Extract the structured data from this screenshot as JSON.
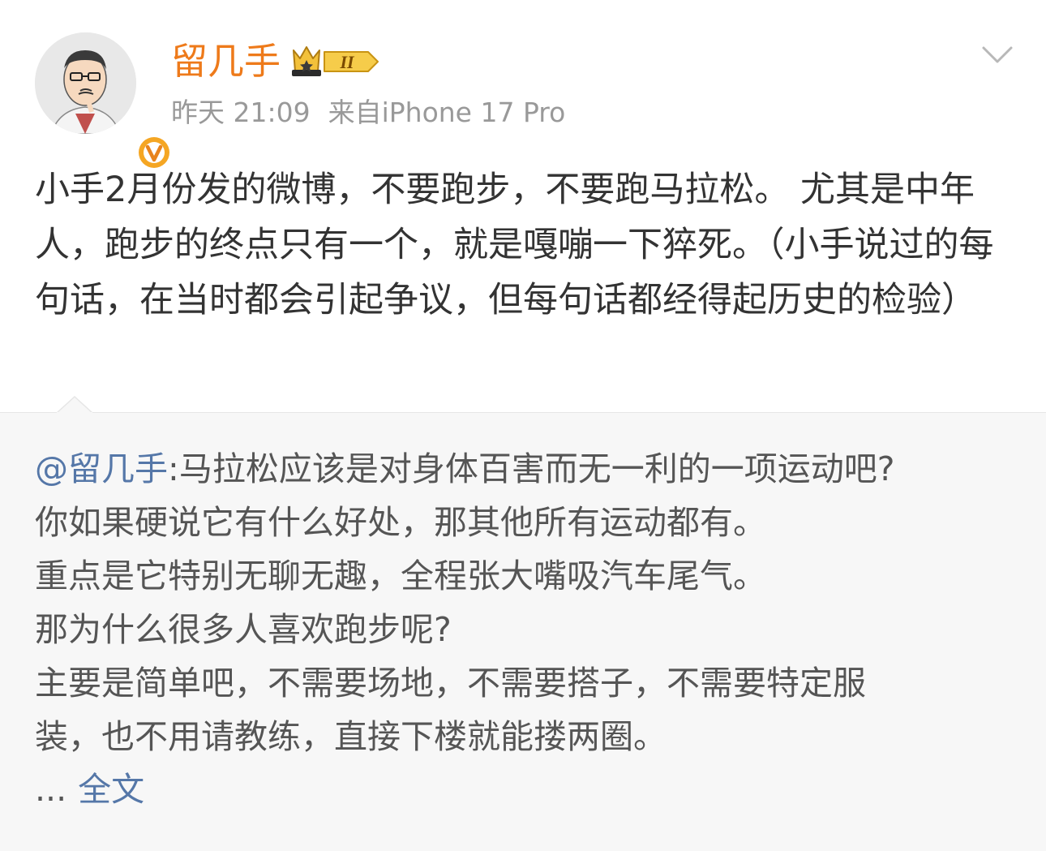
{
  "post": {
    "username": "留几手",
    "timestamp": "昨天 21:09",
    "source": "来自iPhone 17 Pro",
    "vip_level": "II",
    "avatar_icon": "cartoon-avatar-icon",
    "verified_icon": "verified-v-icon",
    "menu_icon": "chevron-down-icon",
    "content": "小手2月份发的微博，不要跑步，不要跑马拉松。 尤其是中年人，跑步的终点只有一个，就是嘎嘣一下猝死。（小手说过的每句话，在当时都会引起争议，但每句话都经得起历史的检验）"
  },
  "repost": {
    "mention": "@留几手",
    "first_line_rest": ":马拉松应该是对身体百害而无一利的一项运动吧?",
    "lines": [
      "你如果硬说它有什么好处，那其他所有运动都有。",
      "重点是它特别无聊无趣，全程张大嘴吸汽车尾气。",
      "那为什么很多人喜欢跑步呢?",
      "主要是简单吧，不需要场地，不需要搭子，不需要特定服",
      "装，也不用请教练，直接下楼就能搂两圈。"
    ],
    "ellipsis": "...",
    "full_text_link": "全文"
  },
  "colors": {
    "username": "#ee7a1a",
    "meta": "#999999",
    "body_text": "#333333",
    "repost_bg": "#f7f7f7",
    "link": "#5577a8",
    "verified": "#f5a623"
  }
}
